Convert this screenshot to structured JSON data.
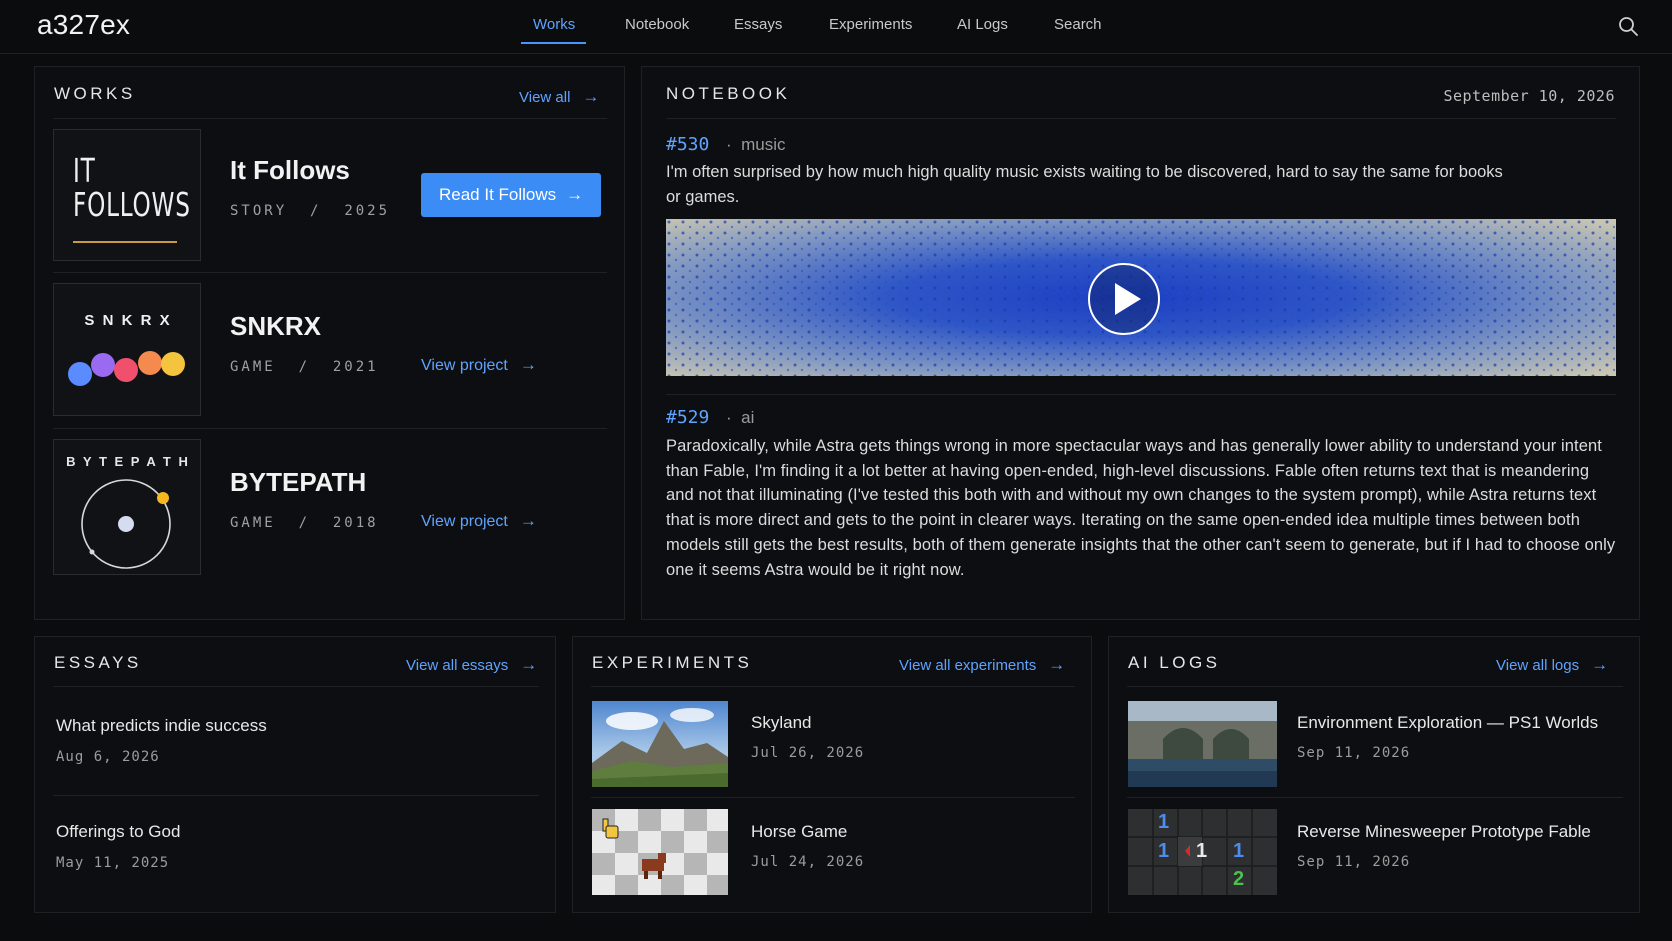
{
  "nav": {
    "logo": "a327ex",
    "links": [
      "Works",
      "Notebook",
      "Essays",
      "Experiments",
      "AI Logs",
      "Search"
    ]
  },
  "works": {
    "title": "WORKS",
    "view_all": "View all",
    "items": [
      {
        "title": "It Follows",
        "kind": "STORY",
        "year": "2025",
        "action": "Read It Follows",
        "thumb_text": [
          "IT",
          "FOLLOWS"
        ]
      },
      {
        "title": "SNKRX",
        "kind": "GAME",
        "year": "2021",
        "action": "View project",
        "thumb_text": "S N K R X"
      },
      {
        "title": "BYTEPATH",
        "kind": "GAME",
        "year": "2018",
        "action": "View project",
        "thumb_text": "B Y T E P A T H"
      }
    ],
    "separator": "/"
  },
  "notebook": {
    "title": "NOTEBOOK",
    "date": "September 10, 2026",
    "entries": [
      {
        "id": "#530",
        "tag": "music",
        "text": "I'm often surprised by how much high quality music exists waiting to be discovered, hard to say the same for books or games."
      },
      {
        "id": "#529",
        "tag": "ai",
        "text": "Paradoxically, while Astra gets things wrong in more spectacular ways and has generally lower ability to understand your intent than Fable, I'm finding it a lot better at having open-ended, high-level discussions. Fable often returns text that is meandering and not that illuminating (I've tested this both with and without my own changes to the system prompt), while Astra returns text that is more direct and gets to the point in clearer ways. Iterating on the same open-ended idea multiple times between both models still gets the best results, both of them generate insights that the other can't seem to generate, but if I had to choose only one it seems Astra would be it right now."
      }
    ],
    "dot": "·"
  },
  "essays": {
    "title": "ESSAYS",
    "view_all": "View all essays",
    "items": [
      {
        "title": "What predicts indie success",
        "date": "Aug 6, 2026"
      },
      {
        "title": "Offerings to God",
        "date": "May 11, 2025"
      }
    ]
  },
  "experiments": {
    "title": "EXPERIMENTS",
    "view_all": "View all experiments",
    "items": [
      {
        "title": "Skyland",
        "date": "Jul 26, 2026"
      },
      {
        "title": "Horse Game",
        "date": "Jul 24, 2026"
      }
    ]
  },
  "ailogs": {
    "title": "AI LOGS",
    "view_all": "View all logs",
    "items": [
      {
        "title": "Environment Exploration — PS1 Worlds",
        "date": "Sep 11, 2026"
      },
      {
        "title": "Reverse Minesweeper Prototype Fable",
        "date": "Sep 11, 2026"
      }
    ],
    "mine_numbers": [
      "1",
      "1",
      "1",
      "1",
      "2"
    ]
  },
  "colors": {
    "accent": "#5fa3ff",
    "button": "#3b8cf5",
    "background": "#0b0c0e"
  }
}
